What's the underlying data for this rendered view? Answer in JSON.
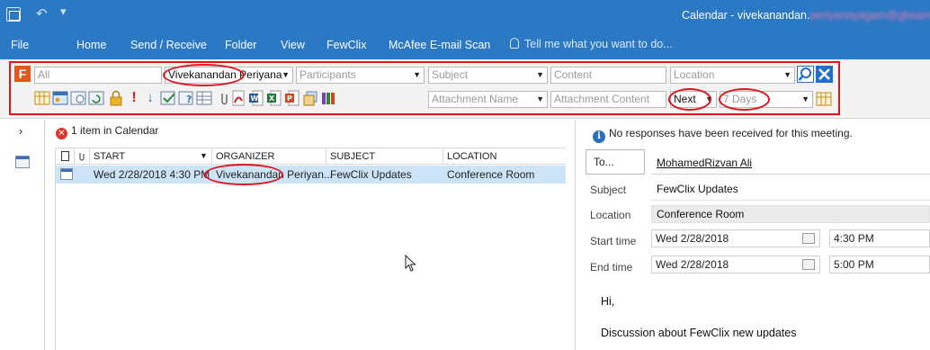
{
  "window": {
    "title_prefix": "Calendar - vivekanandan.",
    "title_blurred": "periyanayagam@gbsame"
  },
  "ribbon": {
    "tabs": [
      {
        "label": "File"
      },
      {
        "label": "Home"
      },
      {
        "label": "Send / Receive"
      },
      {
        "label": "Folder"
      },
      {
        "label": "View"
      },
      {
        "label": "FewClix"
      },
      {
        "label": "McAfee E-mail Scan"
      }
    ],
    "tell_me": "Tell me what you want to do..."
  },
  "fewclix": {
    "row1": {
      "search_placeholder": "All",
      "organizer": "Vivekanandan Periyana",
      "participants": "Participants",
      "subject": "Subject",
      "content": "Content",
      "location": "Location"
    },
    "row2": {
      "attachment_name": "Attachment Name",
      "attachment_content": "Attachment Content",
      "direction": "Next",
      "range": "7 Days"
    }
  },
  "list": {
    "count_text": "1 item in Calendar",
    "columns": [
      "START",
      "ORGANIZER",
      "SUBJECT",
      "LOCATION"
    ],
    "rows": [
      {
        "start": "Wed 2/28/2018 4:30 PM",
        "organizer": "Vivekanandan Periyan...",
        "subject": "FewClix Updates",
        "location": "Conference Room"
      }
    ]
  },
  "reading": {
    "info": "No responses have been received for this meeting.",
    "to_label": "To...",
    "to_value": "MohamedRizvan Ali",
    "subject_label": "Subject",
    "subject_value": "FewClix Updates",
    "location_label": "Location",
    "location_value": "Conference Room",
    "start_label": "Start time",
    "start_date": "Wed 2/28/2018",
    "start_time": "4:30 PM",
    "end_label": "End time",
    "end_date": "Wed 2/28/2018",
    "end_time": "5:00 PM",
    "body_greeting": "Hi,",
    "body_line": "Discussion about FewClix new updates"
  },
  "colors": {
    "ribbon": "#2b78c4",
    "highlight": "#e0141e",
    "selected_row": "#cde4f7"
  }
}
